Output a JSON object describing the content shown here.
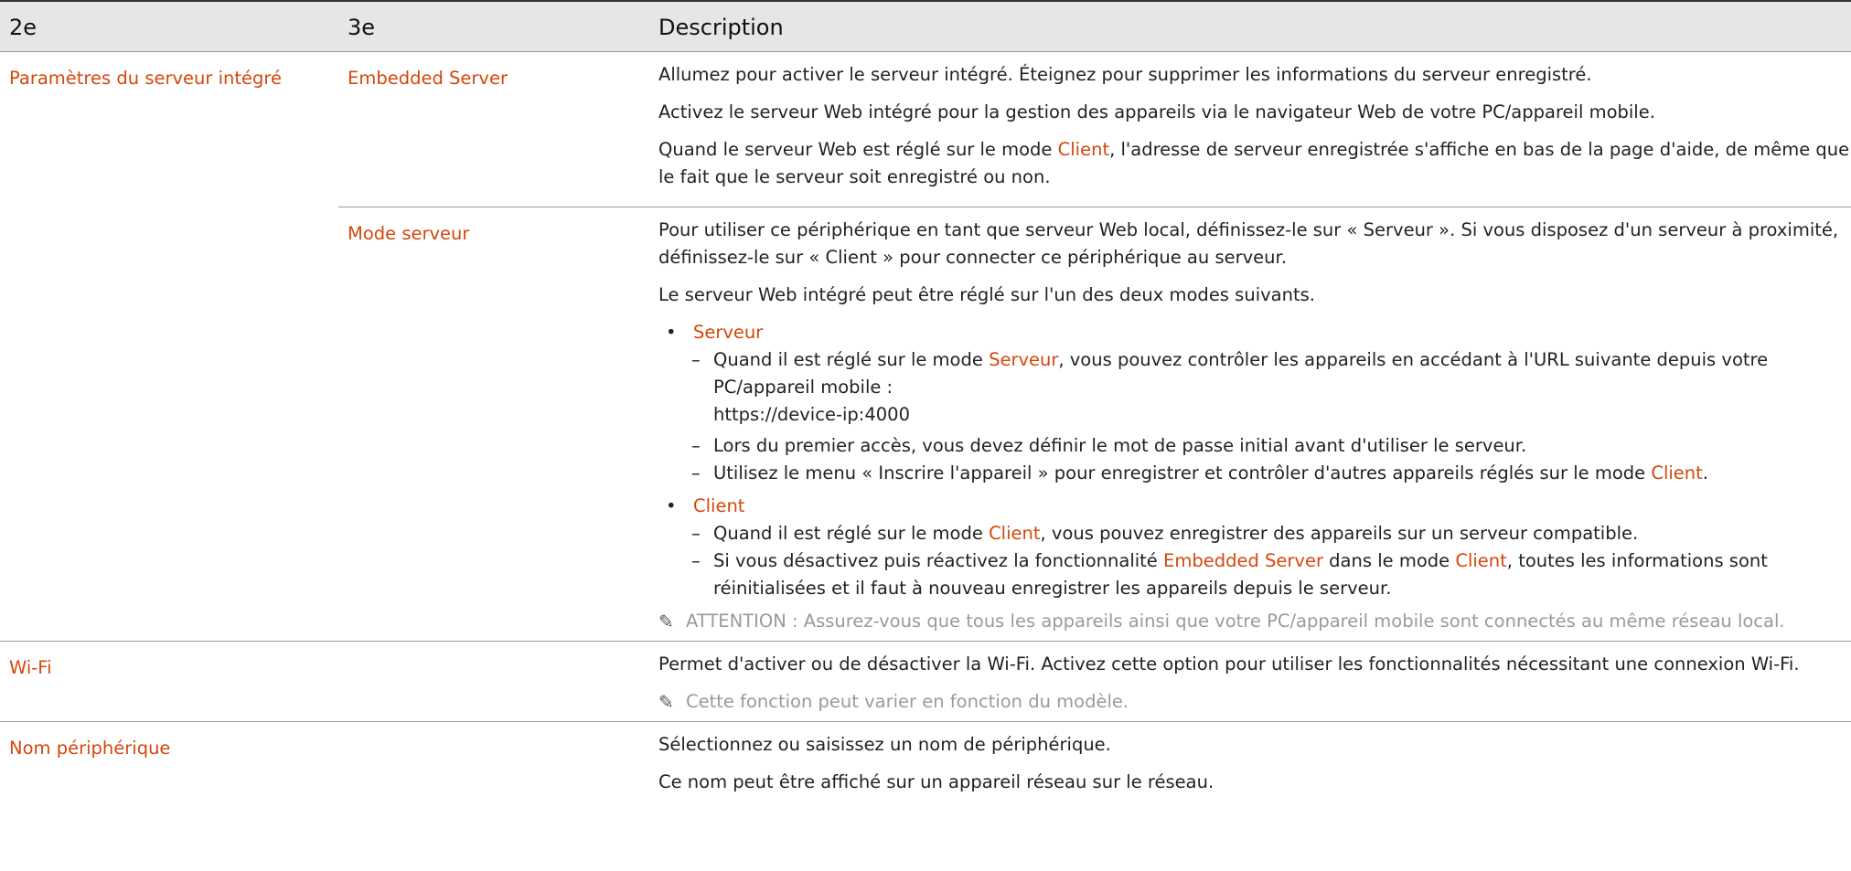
{
  "headers": {
    "col2": "2e",
    "col3": "3e",
    "desc": "Description"
  },
  "rows": {
    "embedded": {
      "c2": "Paramètres du serveur intégré",
      "c3": "Embedded Server",
      "p1": "Allumez pour activer le serveur intégré. Éteignez pour supprimer les informations du serveur enregistré.",
      "p2": "Activez le serveur Web intégré pour la gestion des appareils via le navigateur Web de votre PC/appareil mobile.",
      "p3_a": "Quand le serveur Web est réglé sur le mode ",
      "p3_hl": "Client",
      "p3_b": ", l'adresse de serveur enregistrée s'affiche en bas de la page d'aide, de même que le fait que le serveur soit enregistré ou non."
    },
    "mode": {
      "c3": "Mode serveur",
      "p1": "Pour utiliser ce périphérique en tant que serveur Web local, définissez-le sur « Serveur ». Si vous disposez d'un serveur à proximité, définissez-le sur « Client » pour connecter ce périphérique au serveur.",
      "p2": "Le serveur Web intégré peut être réglé sur l'un des deux modes suivants.",
      "bullet1": "Serveur",
      "b1_d1_a": "Quand il est réglé sur le mode ",
      "b1_d1_hl": "Serveur",
      "b1_d1_b": ", vous pouvez contrôler les appareils en accédant à l'URL suivante depuis votre PC/appareil mobile :",
      "b1_url": "https://device-ip:4000",
      "b1_d2": "Lors du premier accès, vous devez définir le mot de passe initial avant d'utiliser le serveur.",
      "b1_d3_a": "Utilisez le menu « Inscrire l'appareil » pour enregistrer et contrôler d'autres appareils réglés sur le mode ",
      "b1_d3_hl": "Client",
      "b1_d3_b": ".",
      "bullet2": "Client",
      "b2_d1_a": "Quand il est réglé sur le mode ",
      "b2_d1_hl": "Client",
      "b2_d1_b": ", vous pouvez enregistrer des appareils sur un serveur compatible.",
      "b2_d2_a": "Si vous désactivez puis réactivez la fonctionnalité ",
      "b2_d2_hl1": "Embedded Server",
      "b2_d2_b": " dans le mode ",
      "b2_d2_hl2": "Client",
      "b2_d2_c": ", toutes les informations sont réinitialisées et il faut à nouveau enregistrer les appareils depuis le serveur.",
      "note": "ATTENTION : Assurez-vous que tous les appareils ainsi que votre PC/appareil mobile sont connectés au même réseau local."
    },
    "wifi": {
      "c2": "Wi-Fi",
      "p1": "Permet d'activer ou de désactiver la Wi-Fi. Activez cette option pour utiliser les fonctionnalités nécessitant une connexion Wi-Fi.",
      "note": "Cette fonction peut varier en fonction du modèle."
    },
    "name": {
      "c2": "Nom périphérique",
      "p1": "Sélectionnez ou saisissez un nom de périphérique.",
      "p2": "Ce nom peut être affiché sur un appareil réseau sur le réseau."
    }
  }
}
